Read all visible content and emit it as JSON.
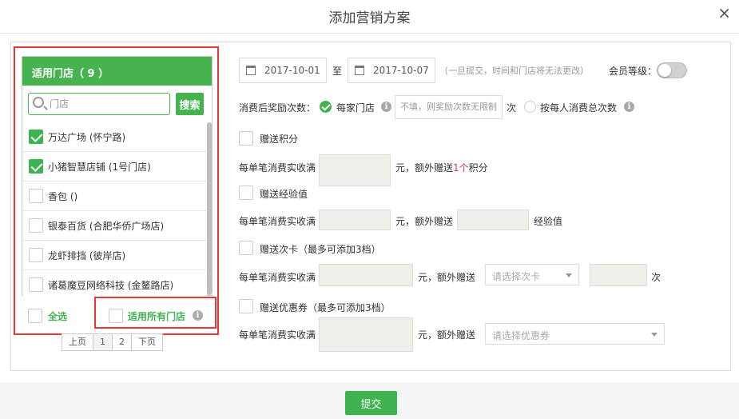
{
  "dialog": {
    "title": "添加营销方案",
    "close": "×"
  },
  "stores": {
    "header": "适用门店（ 9 ）",
    "search_placeholder": "门店",
    "search_button": "搜索",
    "items": [
      {
        "name": "万达广场 (怀宁路)",
        "checked": true
      },
      {
        "name": "小猪智慧店铺 (1号门店)",
        "checked": true
      },
      {
        "name": "香包 ()",
        "checked": false
      },
      {
        "name": "银泰百货 (合肥华侨广场店)",
        "checked": false
      },
      {
        "name": "龙虾排挡 (彼岸店)",
        "checked": false
      },
      {
        "name": "诸葛魔豆网络科技 (金鳌路店)",
        "checked": false
      }
    ],
    "select_all": "全选",
    "all_stores": "适用所有门店",
    "info_glyph": "i"
  },
  "pager": {
    "prev": "上页",
    "page1": "1",
    "page2": "2",
    "next": "下页"
  },
  "form": {
    "date_start": "2017-10-01",
    "date_to": "至",
    "date_end": "2017-10-07",
    "date_note": "（一旦提交，时间和门店将无法更改）",
    "member_level": "会员等级：",
    "reward_times_label": "消费后奖励次数：",
    "per_store": "每家门店",
    "per_store_placeholder": "不填，则奖励次数无限制",
    "times_unit": "次",
    "per_person": "按每人消费总次数",
    "points": {
      "title": "赠送积分",
      "per_spend": "每单笔消费实收满",
      "suffix_a": "元，额外赠送",
      "amount": "1个",
      "suffix_b": "积分"
    },
    "exp": {
      "title": "赠送经验值",
      "per_spend": "每单笔消费实收满",
      "suffix_a": "元，额外赠送",
      "suffix_b": "经验值"
    },
    "card": {
      "title": "赠送次卡（最多可添加3档）",
      "per_spend": "每单笔消费实收满",
      "suffix_a": "元，额外赠送",
      "select_placeholder": "请选择次卡",
      "suffix_b": "次"
    },
    "coupon": {
      "title": "赠送优惠券（最多可添加3档）",
      "per_spend": "每单笔消费实收满",
      "suffix_a": "元，额外赠送",
      "select_placeholder": "请选择优惠券"
    }
  },
  "footer": {
    "submit": "提交"
  },
  "colors": {
    "accent": "#3fb34f",
    "highlight": "#e53935"
  }
}
